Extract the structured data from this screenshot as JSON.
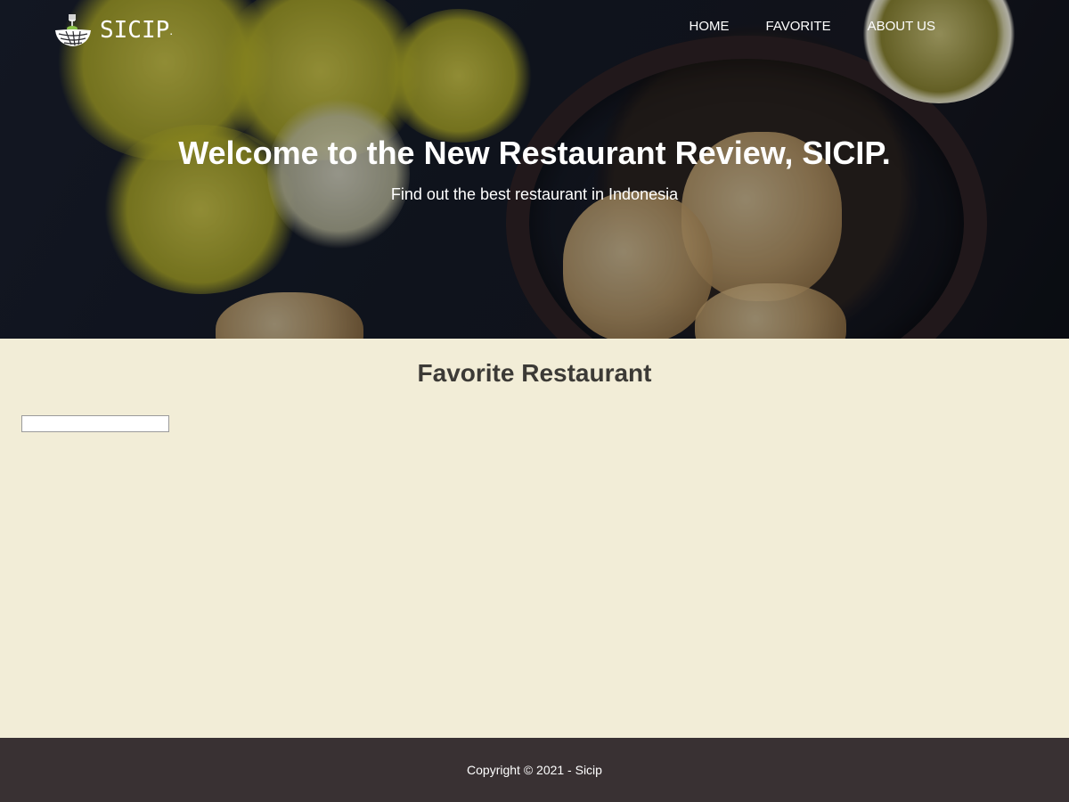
{
  "brand": {
    "name": "SICIP",
    "dot": ".",
    "logo_icon": "bowl-fork-icon"
  },
  "nav": {
    "items": [
      {
        "label": "HOME"
      },
      {
        "label": "FAVORITE"
      },
      {
        "label": "ABOUT US"
      }
    ]
  },
  "hero": {
    "title": "Welcome to the New Restaurant Review, SICIP.",
    "subtitle": "Find out the best restaurant in Indonesia"
  },
  "favorite": {
    "title": "Favorite Restaurant"
  },
  "footer": {
    "copyright": "Copyright © 2021 - Sicip"
  },
  "colors": {
    "main_background": "#f2edd7",
    "footer_background": "#393133",
    "heading_text": "#3c3a36",
    "logo_accent": "#8bc34a"
  }
}
